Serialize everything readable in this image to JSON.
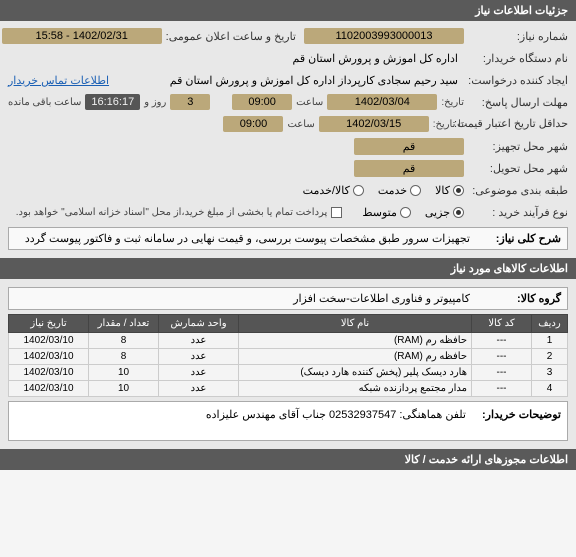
{
  "headers": {
    "details": "جزئیات اطلاعات نیاز",
    "items_section": "اطلاعات کالاهای مورد نیاز",
    "permits_section": "اطلاعات مجوزهای ارائه خدمت / کالا"
  },
  "labels": {
    "need_no": "شماره نیاز:",
    "announce_dt": "تاریخ و ساعت اعلان عمومی:",
    "buyer_org": "نام دستگاه خریدار:",
    "requester": "ایجاد کننده درخواست:",
    "buyer_contact_link": "اطلاعات تماس خریدار",
    "reply_deadline": "مهلت ارسال پاسخ:",
    "date_lbl": "تاریخ:",
    "time_lbl": "ساعت",
    "and_lbl": "و",
    "day_lbl": "روز و",
    "remaining_lbl": "ساعت باقی مانده",
    "price_valid": "حداقل تاریخ اعتبار قیمت:",
    "until_date": "تا تاریخ:",
    "subject_city": "شهر محل تجهیز:",
    "delivery_city": "شهر محل تحویل:",
    "classification": "طبقه بندی موضوعی:",
    "goods_lbl": "کالا",
    "service_lbl": "خدمت",
    "goods_service_lbl": "کالا/خدمت",
    "purchase_type": "نوع فرآیند خرید :",
    "minor": "جزیی",
    "medium": "متوسط",
    "payment_note": "پرداخت تمام یا بخشی از مبلغ خرید،از محل \"اسناد خزانه اسلامی\" خواهد بود.",
    "need_desc_lbl": "شرح کلی نیاز:",
    "goods_group_lbl": "گروه کالا:",
    "buyer_notes_lbl": "توضیحات خریدار:"
  },
  "values": {
    "need_no": "1102003993000013",
    "announce_dt": "1402/02/31 - 15:58",
    "buyer_org": "اداره کل اموزش و پرورش استان قم",
    "requester": "سید رحیم سجادی کارپرداز اداره کل اموزش و پرورش استان قم",
    "reply_date": "1402/03/04",
    "reply_time": "09:00",
    "remain_days": "3",
    "remain_time": "16:16:17",
    "price_valid_date": "1402/03/15",
    "price_valid_time": "09:00",
    "subject_city": "قم",
    "delivery_city": "قم",
    "need_desc": "تجهیزات سرور طبق مشخصات پیوست بررسی، و قیمت نهایی در سامانه ثبت و فاکتور پیوست گردد",
    "goods_group": "کامپیوتر و فناوری اطلاعات-سخت افزار",
    "buyer_notes": "تلفن هماهنگی:  02532937547 جناب آقای مهندس علیزاده"
  },
  "table": {
    "cols": {
      "row": "ردیف",
      "code": "کد کالا",
      "name": "نام کالا",
      "unit": "واحد شمارش",
      "qty": "تعداد / مقدار",
      "need_date": "تاریخ نیاز"
    },
    "rows": [
      {
        "n": "1",
        "code": "---",
        "name": "حافظه رم (RAM)",
        "unit": "عدد",
        "qty": "8",
        "date": "1402/03/10"
      },
      {
        "n": "2",
        "code": "---",
        "name": "حافظه رم (RAM)",
        "unit": "عدد",
        "qty": "8",
        "date": "1402/03/10"
      },
      {
        "n": "3",
        "code": "---",
        "name": "هارد دیسک پلیر (پخش کننده هارد دیسک)",
        "unit": "عدد",
        "qty": "10",
        "date": "1402/03/10"
      },
      {
        "n": "4",
        "code": "---",
        "name": "مدار مجتمع پردازنده شبکه",
        "unit": "عدد",
        "qty": "10",
        "date": "1402/03/10"
      }
    ]
  }
}
